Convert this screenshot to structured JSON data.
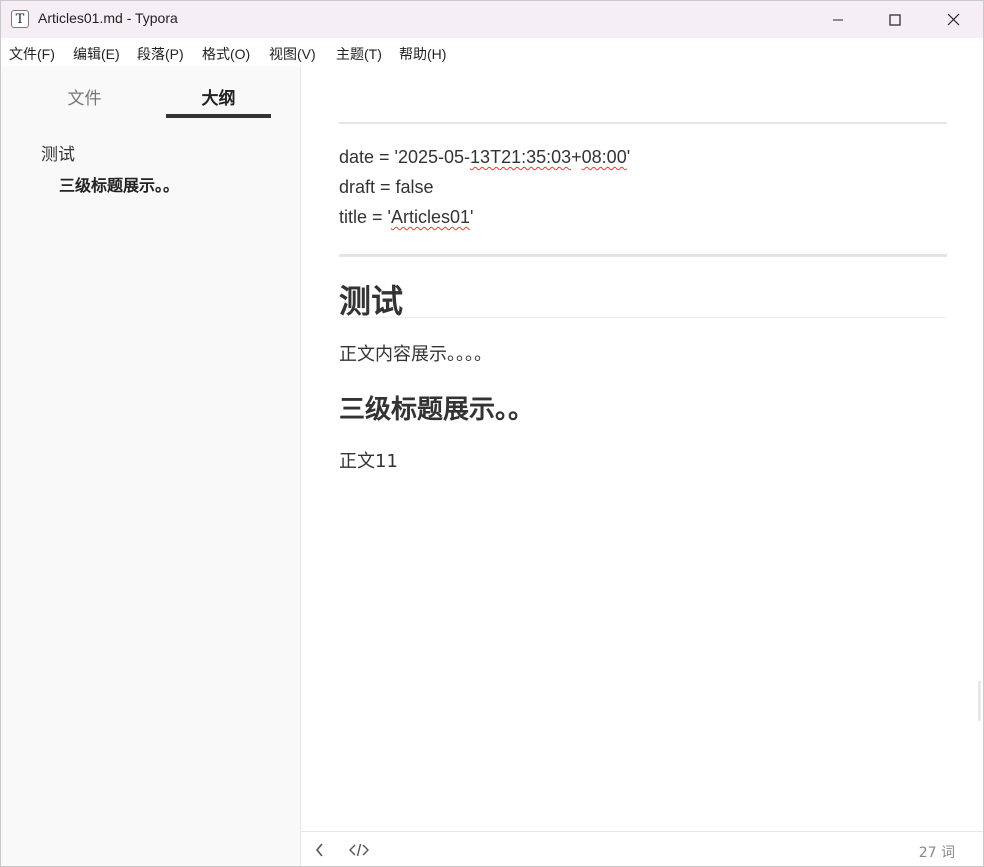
{
  "window": {
    "app_icon_letter": "T",
    "title": "Articles01.md - Typora"
  },
  "menu": [
    "文件(F)",
    "编辑(E)",
    "段落(P)",
    "格式(O)",
    "视图(V)",
    "主题(T)",
    "帮助(H)"
  ],
  "sidebar": {
    "tabs": [
      "文件",
      "大纲"
    ],
    "active_tab": "大纲",
    "outline": [
      {
        "level": 1,
        "text": "测试"
      },
      {
        "level": 3,
        "text": "三级标题展示。。"
      }
    ]
  },
  "editor": {
    "front_matter": {
      "date_prefix": "date = '2025-05-",
      "date_misspelled_1": "13T21:35:03",
      "date_sep": "+",
      "date_misspelled_2": "08:00",
      "date_suffix": "'",
      "draft_line": "draft = false",
      "title_prefix": "title = '",
      "title_misspelled": "Articles01",
      "title_suffix": "'"
    },
    "h1": "测试",
    "paragraph1": "正文内容展示。。。。",
    "h3": "三级标题展示。。",
    "paragraph2": "正文11"
  },
  "footer": {
    "word_count": "27 词"
  },
  "icons": {
    "back": "chevron-left-icon",
    "source": "code-icon",
    "minimize": "minimize-icon",
    "maximize": "maximize-icon",
    "close": "close-icon"
  }
}
